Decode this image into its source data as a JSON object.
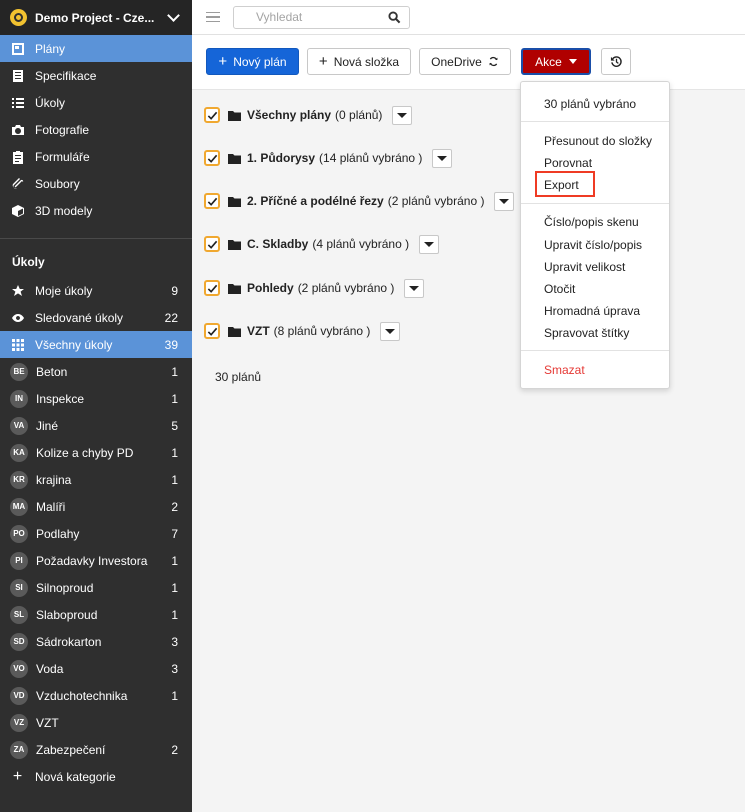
{
  "sidebar": {
    "project": "Demo Project - Cze...",
    "nav": [
      {
        "label": "Plány",
        "icon": "plans-icon",
        "active": true
      },
      {
        "label": "Specifikace",
        "icon": "specification-icon"
      },
      {
        "label": "Úkoly",
        "icon": "list-icon"
      },
      {
        "label": "Fotografie",
        "icon": "camera-icon"
      },
      {
        "label": "Formuláře",
        "icon": "clipboard-icon"
      },
      {
        "label": "Soubory",
        "icon": "paperclip-icon"
      },
      {
        "label": "3D modely",
        "icon": "cube-icon"
      }
    ],
    "tasks_title": "Úkoly",
    "task_filters": [
      {
        "label": "Moje úkoly",
        "count": "9",
        "icon": "star-icon"
      },
      {
        "label": "Sledované úkoly",
        "count": "22",
        "icon": "eye-icon"
      },
      {
        "label": "Všechny úkoly",
        "count": "39",
        "icon": "grid-icon",
        "active": true
      }
    ],
    "categories": [
      {
        "abbr": "BE",
        "label": "Beton",
        "count": "1"
      },
      {
        "abbr": "IN",
        "label": "Inspekce",
        "count": "1"
      },
      {
        "abbr": "VA",
        "label": "Jiné",
        "count": "5"
      },
      {
        "abbr": "KA",
        "label": "Kolize a chyby PD",
        "count": "1"
      },
      {
        "abbr": "KR",
        "label": "krajina",
        "count": "1"
      },
      {
        "abbr": "MA",
        "label": "Malíři",
        "count": "2"
      },
      {
        "abbr": "PO",
        "label": "Podlahy",
        "count": "7"
      },
      {
        "abbr": "PI",
        "label": "Požadavky Investora",
        "count": "1"
      },
      {
        "abbr": "SI",
        "label": "Silnoproud",
        "count": "1"
      },
      {
        "abbr": "SL",
        "label": "Slaboproud",
        "count": "1"
      },
      {
        "abbr": "SD",
        "label": "Sádrokarton",
        "count": "3"
      },
      {
        "abbr": "VO",
        "label": "Voda",
        "count": "3"
      },
      {
        "abbr": "VD",
        "label": "Vzduchotechnika",
        "count": "1"
      },
      {
        "abbr": "VZ",
        "label": "VZT",
        "count": ""
      },
      {
        "abbr": "ZA",
        "label": "Zabezpečení",
        "count": "2"
      }
    ],
    "new_category": "Nová kategorie"
  },
  "search": {
    "placeholder": "Vyhledat"
  },
  "toolbar": {
    "new_plan": "Nový plán",
    "new_folder": "Nová složka",
    "onedrive": "OneDrive",
    "actions": "Akce"
  },
  "folders": [
    {
      "name": "Všechny plány",
      "meta": "(0 plánů)"
    },
    {
      "name": "1. Půdorysy",
      "meta": "(14 plánů vybráno )"
    },
    {
      "name": "2. Příčné a podélné řezy",
      "meta": "(2 plánů vybráno )"
    },
    {
      "name": "C. Skladby",
      "meta": "(4 plánů vybráno )"
    },
    {
      "name": "Pohledy",
      "meta": "(2 plánů vybráno )"
    },
    {
      "name": "VZT",
      "meta": "(8 plánů vybráno )"
    }
  ],
  "total": "30 plánů",
  "menu": {
    "selected": "30 plánů vybráno",
    "items": [
      "Přesunout do složky",
      "Porovnat",
      "Export",
      "Číslo/popis skenu",
      "Upravit číslo/popis",
      "Upravit velikost",
      "Otočit",
      "Hromadná úprava",
      "Spravovat štítky"
    ],
    "delete": "Smazat"
  }
}
